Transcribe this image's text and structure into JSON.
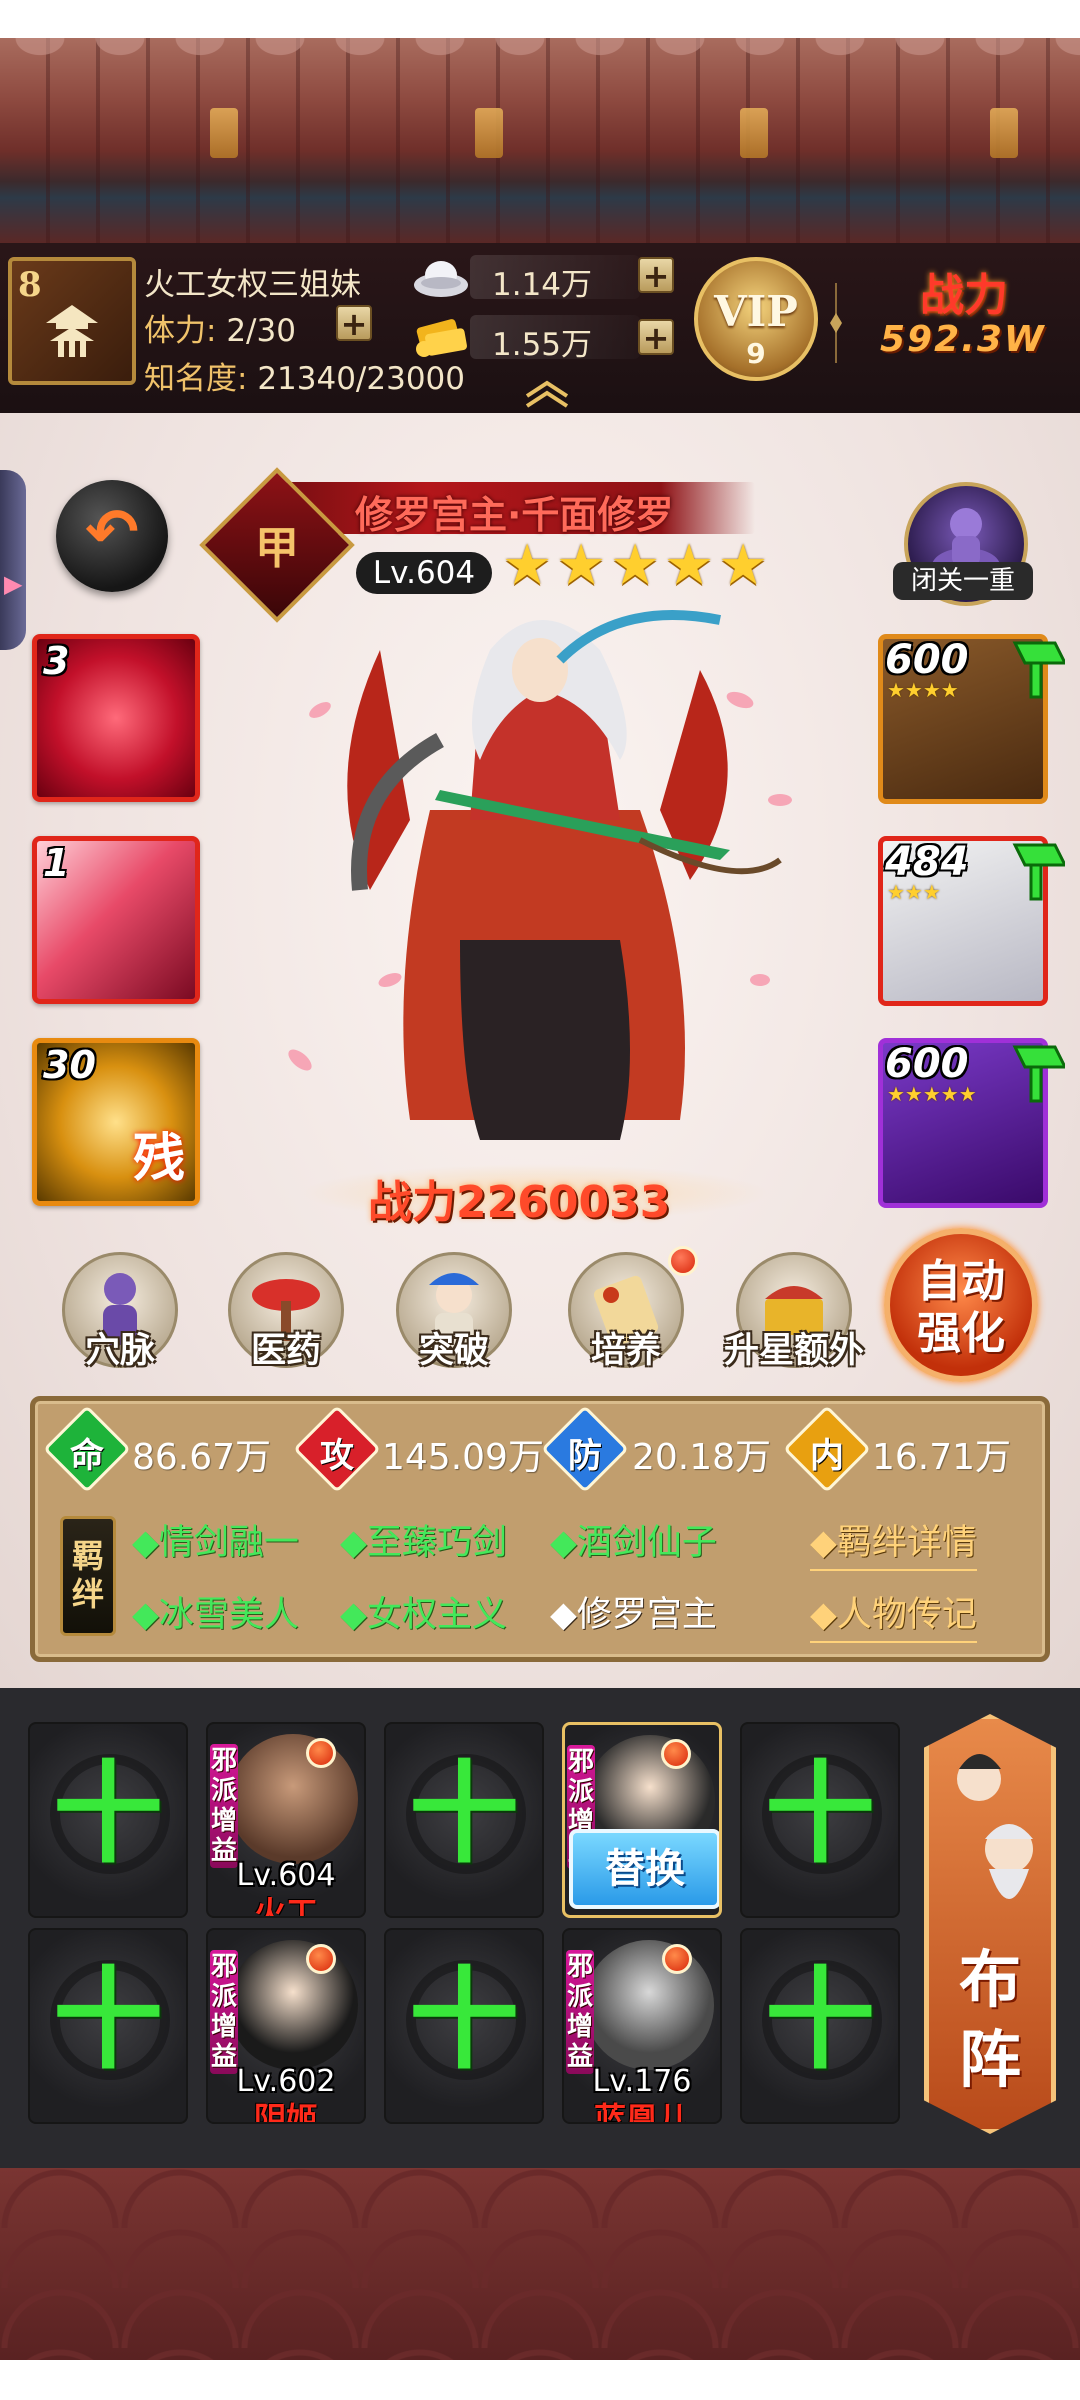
{
  "colors": {
    "accent_red": "#e0261a",
    "gold": "#f5d58a",
    "bond_active": "#43e85a",
    "link": "#ffd27a",
    "star": "#ffcf2e",
    "lineup_bg": "#2a2a2e"
  },
  "player": {
    "rank_number": "8",
    "name": "火工女权三姐妹",
    "stamina_label": "体力:",
    "stamina_value": "2/30",
    "fame_label": "知名度:",
    "fame_value": "21340/23000"
  },
  "currency": {
    "silver": "1.14万",
    "gold": "1.55万",
    "plus": "+"
  },
  "vip": {
    "label": "VIP",
    "level": "9"
  },
  "power": {
    "label": "战力",
    "value": "592.3W"
  },
  "hero": {
    "name": "修罗宫主·千面修罗",
    "rank": "甲",
    "level": "Lv.604",
    "stars": 5,
    "power_label": "战力",
    "power_value": "2260033",
    "meditation_label": "闭关一重"
  },
  "back_icon": "↶",
  "skills": [
    {
      "count": "3",
      "sub": ""
    },
    {
      "count": "1",
      "sub": ""
    },
    {
      "count": "30",
      "sub": "残"
    }
  ],
  "equipment": [
    {
      "level": "600",
      "stars": 4
    },
    {
      "level": "484",
      "stars": 3
    },
    {
      "level": "600",
      "stars": 5
    }
  ],
  "functions": [
    {
      "label": "穴脉",
      "dot": false
    },
    {
      "label": "医药",
      "dot": false
    },
    {
      "label": "突破",
      "dot": false
    },
    {
      "label": "培养",
      "dot": true
    },
    {
      "label": "升星额外",
      "dot": false
    }
  ],
  "auto_enhance": {
    "line1": "自动",
    "line2": "强化"
  },
  "stats": [
    {
      "char": "命",
      "value": "86.67万",
      "color": "#1eb33a"
    },
    {
      "char": "攻",
      "value": "145.09万",
      "color": "#d8202a"
    },
    {
      "char": "防",
      "value": "20.18万",
      "color": "#2a7ae0"
    },
    {
      "char": "内",
      "value": "16.71万",
      "color": "#e8a010"
    }
  ],
  "bond_tag": "羁绊",
  "bonds_row1": [
    "◆情剑融一",
    "◆至臻巧剑",
    "◆酒剑仙子"
  ],
  "bonds_row2": [
    "◆冰雪美人",
    "◆女权主义",
    "◆修罗宫主"
  ],
  "links": {
    "bond_detail": "◆羁绊详情",
    "biography": "◆人物传记"
  },
  "lineup": {
    "empty_symbol": "十",
    "evil_tag": "邪派增益",
    "swap_label": "替换",
    "heroes": [
      {
        "level": "Lv.604",
        "name": "火工"
      },
      {
        "level": "",
        "name": ""
      },
      {
        "level": "Lv.602",
        "name": "阴姬"
      },
      {
        "level": "Lv.176",
        "name": "蓝凰儿"
      }
    ],
    "formation_label": "布阵"
  }
}
